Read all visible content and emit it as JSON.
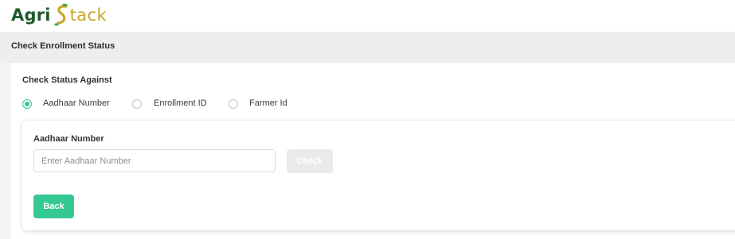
{
  "header": {
    "logo_part1": "Agri",
    "logo_part2": "tack",
    "logo_colors": {
      "agri": "#1f5a2a",
      "stack": "#c8a62a",
      "leaf": "#3aa64a"
    }
  },
  "section": {
    "title": "Check Enrollment Status"
  },
  "status_form": {
    "against_label": "Check Status Against",
    "options": [
      {
        "label": "Aadhaar Number",
        "checked": true
      },
      {
        "label": "Enrollment ID",
        "checked": false
      },
      {
        "label": "Farmer Id",
        "checked": false
      }
    ],
    "field_label": "Aadhaar Number",
    "input_value": "",
    "input_placeholder": "Enter Aadhaar Number",
    "check_label": "Check",
    "check_enabled": false,
    "back_label": "Back"
  },
  "colors": {
    "accent": "#34c992",
    "page_bg": "#f3f4f6",
    "header_bg": "#eceef0",
    "disabled_button": "#e9eaeb"
  }
}
